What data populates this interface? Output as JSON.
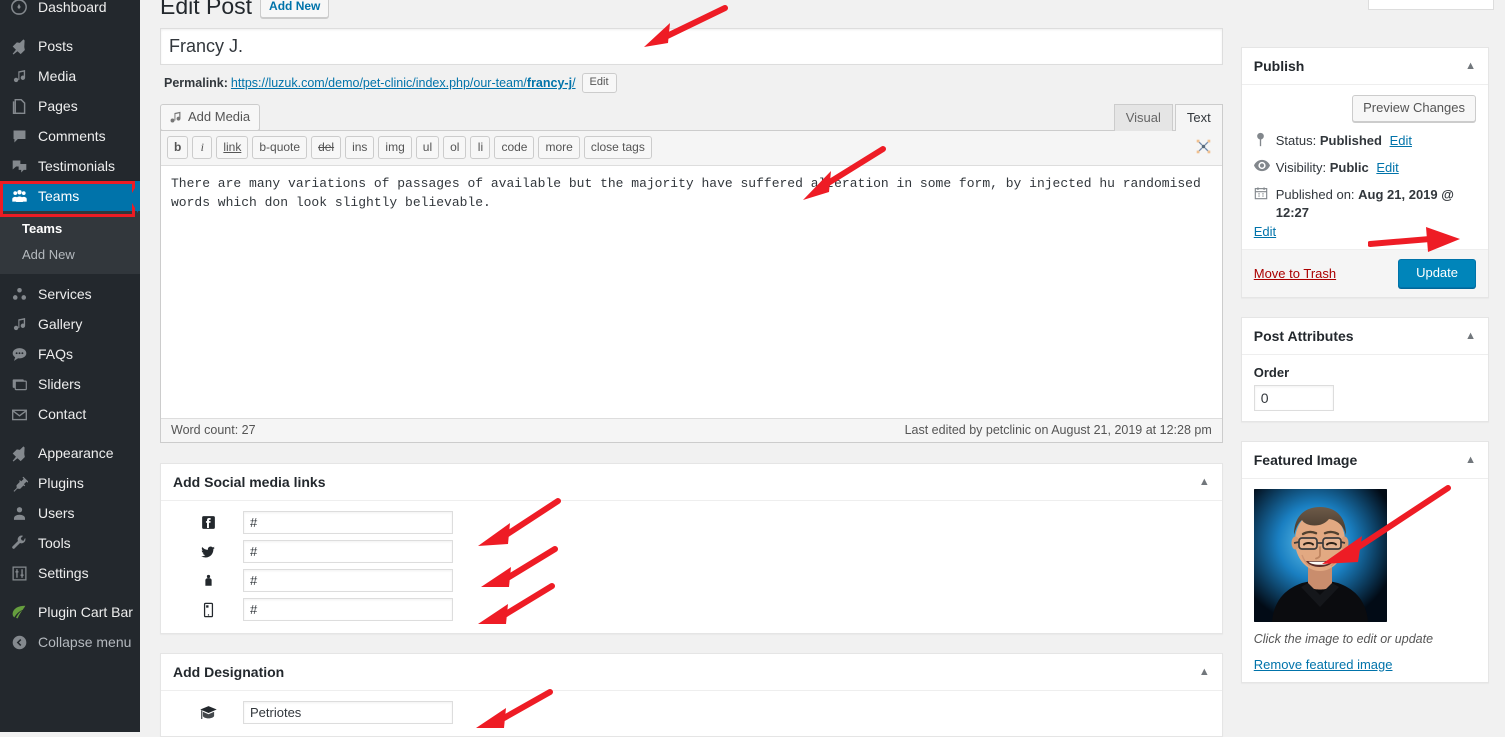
{
  "sidebar": {
    "items": [
      {
        "label": "Dashboard",
        "icon": "dashboard-icon"
      },
      {
        "label": "Posts",
        "icon": "pin-icon"
      },
      {
        "label": "Media",
        "icon": "media-icon"
      },
      {
        "label": "Pages",
        "icon": "pages-icon"
      },
      {
        "label": "Comments",
        "icon": "comment-icon"
      },
      {
        "label": "Testimonials",
        "icon": "testimonials-icon"
      },
      {
        "label": "Teams",
        "icon": "teams-icon"
      },
      {
        "label": "Services",
        "icon": "services-icon"
      },
      {
        "label": "Gallery",
        "icon": "gallery-icon"
      },
      {
        "label": "FAQs",
        "icon": "faq-icon"
      },
      {
        "label": "Sliders",
        "icon": "sliders-icon"
      },
      {
        "label": "Contact",
        "icon": "mail-icon"
      },
      {
        "label": "Appearance",
        "icon": "appearance-icon"
      },
      {
        "label": "Plugins",
        "icon": "plugins-icon"
      },
      {
        "label": "Users",
        "icon": "users-icon"
      },
      {
        "label": "Tools",
        "icon": "tools-icon"
      },
      {
        "label": "Settings",
        "icon": "settings-icon"
      },
      {
        "label": "Plugin Cart Bar",
        "icon": "leaf-icon"
      },
      {
        "label": "Collapse menu",
        "icon": "collapse-icon"
      }
    ],
    "submenu": [
      {
        "label": "Teams",
        "current": true
      },
      {
        "label": "Add New",
        "current": false
      }
    ],
    "current_item": "Teams",
    "highlight_color": "#ec1c24",
    "active_color": "#0073aa"
  },
  "header": {
    "title": "Edit Post",
    "add_new_label": "Add New"
  },
  "post": {
    "title_value": "Francy J.",
    "permalink_label": "Permalink:",
    "permalink_base": "https://luzuk.com/demo/pet-clinic/index.php/our-team/",
    "permalink_slug": "francy-j",
    "permalink_trailing": "/",
    "edit_slug_label": "Edit"
  },
  "editor": {
    "add_media_label": "Add Media",
    "tabs": [
      {
        "label": "Visual",
        "active": false
      },
      {
        "label": "Text",
        "active": true
      }
    ],
    "quicktags": [
      "b",
      "i",
      "link",
      "b-quote",
      "del",
      "ins",
      "img",
      "ul",
      "ol",
      "li",
      "code",
      "more",
      "close tags"
    ],
    "content": "There are many variations of passages of available but the majority have suffered alteration in some form, by injected hu randomised words which don look slightly believable.",
    "word_count": "Word count: 27",
    "last_edited": "Last edited by petclinic on August 21, 2019 at 12:28 pm",
    "fullscreen_icon": "distraction-free-writing-icon"
  },
  "social_box": {
    "title": "Add Social media links",
    "toggle_icon": "chevron-up-icon",
    "fields": [
      {
        "icon": "facebook-icon",
        "value": "#"
      },
      {
        "icon": "twitter-icon",
        "value": "#"
      },
      {
        "icon": "linkedin-icon",
        "value": "#"
      },
      {
        "icon": "mobile-icon",
        "value": "#"
      }
    ]
  },
  "designation_box": {
    "title": "Add Designation",
    "toggle_icon": "chevron-up-icon",
    "icon": "graduation-cap-icon",
    "value": "Petriotes"
  },
  "publish_box": {
    "title": "Publish",
    "toggle_icon": "chevron-up-icon",
    "preview_label": "Preview Changes",
    "status_label": "Status:",
    "status_value": "Published",
    "status_edit": "Edit",
    "visibility_label": "Visibility:",
    "visibility_value": "Public",
    "visibility_edit": "Edit",
    "published_label": "Published on:",
    "published_value": "Aug 21, 2019 @ 12:27",
    "published_edit": "Edit",
    "trash_label": "Move to Trash",
    "update_label": "Update",
    "update_color": "#0085ba"
  },
  "attributes_box": {
    "title": "Post Attributes",
    "toggle_icon": "chevron-up-icon",
    "order_label": "Order",
    "order_value": "0"
  },
  "featured_box": {
    "title": "Featured Image",
    "toggle_icon": "chevron-up-icon",
    "caption": "Click the image to edit or update",
    "remove_label": "Remove featured image",
    "image_alt": "portrait of a smiling man with glasses on a blue background"
  },
  "annotations": {
    "color": "#ee1c25",
    "arrows": [
      {
        "name": "arrow-to-title"
      },
      {
        "name": "arrow-to-editor-content"
      },
      {
        "name": "arrow-to-update-button"
      },
      {
        "name": "arrow-to-facebook-field"
      },
      {
        "name": "arrow-to-twitter-field"
      },
      {
        "name": "arrow-to-mobile-field"
      },
      {
        "name": "arrow-to-designation-field"
      },
      {
        "name": "arrow-to-featured-image"
      }
    ]
  }
}
